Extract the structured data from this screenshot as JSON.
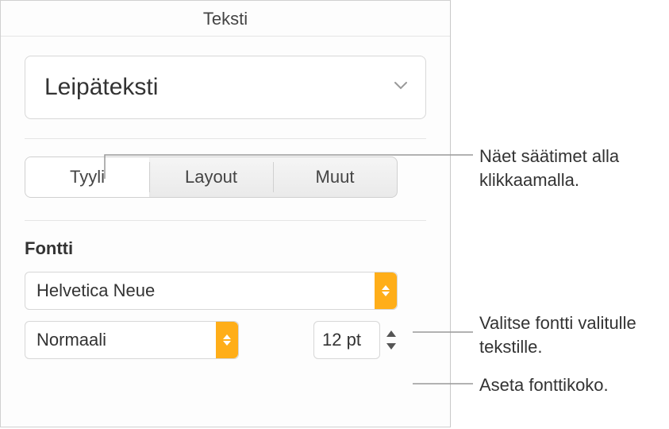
{
  "panel": {
    "title": "Teksti",
    "paragraph_style": "Leipäteksti"
  },
  "tabs": {
    "items": [
      "Tyyli",
      "Layout",
      "Muut"
    ],
    "active_index": 0
  },
  "font": {
    "section_label": "Fontti",
    "family": "Helvetica Neue",
    "style": "Normaali",
    "size": "12 pt"
  },
  "callouts": {
    "tabs": "Näet säätimet alla klikkaamalla.",
    "font_family": "Valitse fontti valitulle tekstille.",
    "font_size": "Aseta fonttikoko."
  }
}
